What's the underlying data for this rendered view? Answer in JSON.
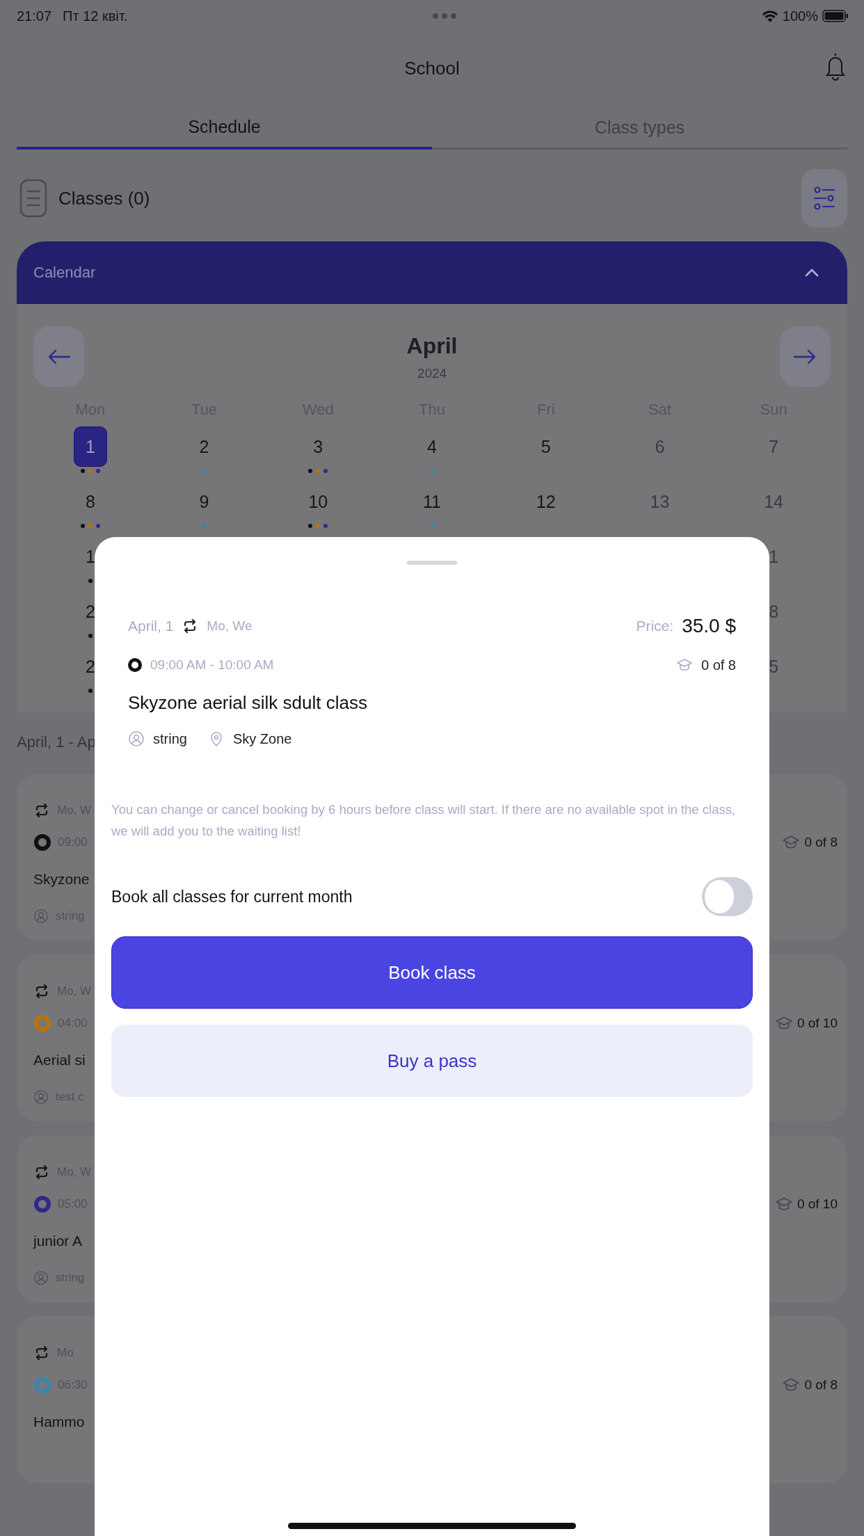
{
  "status_bar": {
    "time": "21:07",
    "date": "Пт 12 квіт.",
    "battery": "100%"
  },
  "header": {
    "title": "School"
  },
  "tabs": [
    {
      "label": "Schedule",
      "selected": true
    },
    {
      "label": "Class types",
      "selected": false
    }
  ],
  "classes_label": "Classes (0)",
  "calendar": {
    "title": "Calendar",
    "expanded": true,
    "month": "April",
    "year": "2024",
    "weekdays": [
      "Mon",
      "Tue",
      "Wed",
      "Thu",
      "Fri",
      "Sat",
      "Sun"
    ],
    "weeks": [
      {
        "days": [
          {
            "date": "1",
            "selected": true,
            "weekend": false,
            "dots": [
              {
                "color": "#111111"
              },
              {
                "color": "#b8730e"
              },
              {
                "color": "#2d2a8a"
              }
            ]
          },
          {
            "date": "2",
            "selected": false,
            "weekend": false,
            "dots": [
              {
                "color": "#3a86a8"
              }
            ]
          },
          {
            "date": "3",
            "selected": false,
            "weekend": false,
            "dots": [
              {
                "color": "#111111"
              },
              {
                "color": "#b8730e"
              },
              {
                "color": "#2d2a8a"
              }
            ]
          },
          {
            "date": "4",
            "selected": false,
            "weekend": false,
            "dots": [
              {
                "color": "#3a86a8"
              }
            ]
          },
          {
            "date": "5",
            "selected": false,
            "weekend": false
          },
          {
            "date": "6",
            "selected": false,
            "weekend": true
          },
          {
            "date": "7",
            "selected": false,
            "weekend": true
          }
        ]
      },
      {
        "days": [
          {
            "date": "8",
            "selected": false,
            "weekend": false,
            "dots": [
              {
                "color": "#111111"
              },
              {
                "color": "#b8730e"
              },
              {
                "color": "#2d2a8a"
              }
            ]
          },
          {
            "date": "9",
            "selected": false,
            "weekend": false,
            "dots": [
              {
                "color": "#3a86a8"
              }
            ]
          },
          {
            "date": "10",
            "selected": false,
            "weekend": false,
            "dots": [
              {
                "color": "#111111"
              },
              {
                "color": "#b8730e"
              },
              {
                "color": "#2d2a8a"
              }
            ]
          },
          {
            "date": "11",
            "selected": false,
            "weekend": false,
            "dots": [
              {
                "color": "#3a86a8"
              }
            ]
          },
          {
            "date": "12",
            "selected": false,
            "weekend": false
          },
          {
            "date": "13",
            "selected": false,
            "weekend": true
          },
          {
            "date": "14",
            "selected": false,
            "weekend": true
          }
        ]
      },
      {
        "first_day": {
          "date": "1",
          "selected": false,
          "weekend": false,
          "dots": [
            {
              "color": "#111111"
            }
          ]
        },
        "last_day": {
          "date": "1",
          "selected": false,
          "weekend": true
        }
      },
      {
        "first_day": {
          "date": "2",
          "selected": false,
          "weekend": false,
          "dots": [
            {
              "color": "#111111"
            }
          ]
        },
        "last_day": {
          "date": "8",
          "selected": false,
          "weekend": true
        }
      },
      {
        "first_day": {
          "date": "2",
          "selected": false,
          "weekend": false,
          "dots": [
            {
              "color": "#111111"
            }
          ]
        },
        "last_day": {
          "date": "5",
          "selected": false,
          "weekend": true
        }
      }
    ]
  },
  "range_label": "April, 1 - Ap",
  "class_cards": [
    {
      "days": "Mo, W",
      "time": "09:00",
      "color": "#111111",
      "title": "Skyzone",
      "instructor": "string",
      "capacity": "0 of 8"
    },
    {
      "days": "Mo, W",
      "time": "04:00",
      "color": "#b8730e",
      "title": "Aerial si",
      "instructor": "test c",
      "capacity": "0 of 10"
    },
    {
      "days": "Mo, W",
      "time": "05:00",
      "color": "#2d2a8a",
      "title": "junior A",
      "instructor": "string",
      "capacity": "0 of 10"
    },
    {
      "days": "Mo",
      "time": "06:30",
      "color": "#3a86a8",
      "title": "Hammo",
      "capacity": "0 of 8"
    }
  ],
  "sheet": {
    "date": "April, 1",
    "repeat_days": "Mo, We",
    "price_label": "Price:",
    "price": "35.0 $",
    "time": "09:00 AM - 10:00 AM",
    "color": "#111111",
    "capacity": "0 of 8",
    "title": "Skyzone aerial silk sdult class",
    "instructor": "string",
    "location": "Sky Zone",
    "note": "You can change or cancel booking by 6 hours before class will start. If there are no available spot in the class, we will add you to the waiting list!",
    "toggle": {
      "label": "Book all classes for current month",
      "on": false
    },
    "buttons": [
      {
        "label": "Book class",
        "kind": "primary"
      },
      {
        "label": "Buy a pass",
        "kind": "secondary"
      }
    ]
  }
}
